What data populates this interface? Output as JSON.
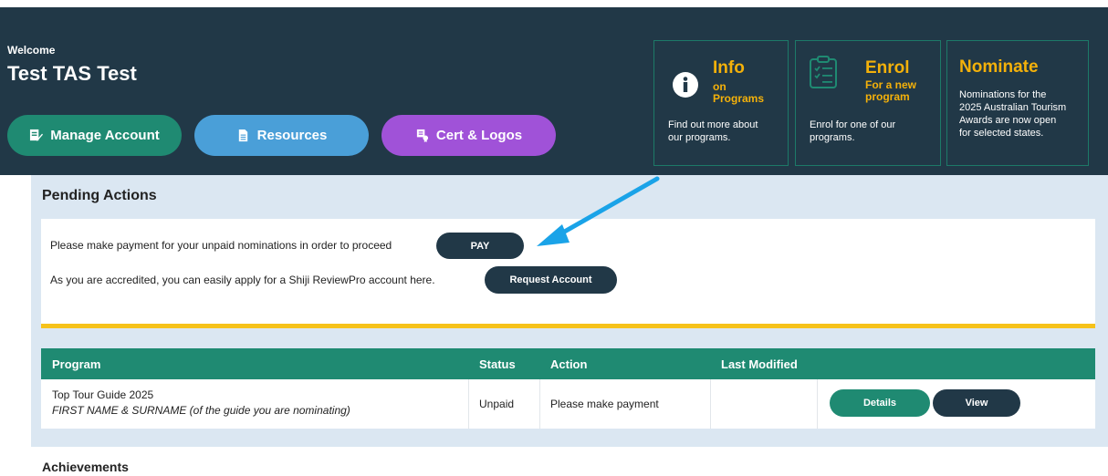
{
  "header": {
    "welcome_label": "Welcome",
    "user_name": "Test TAS Test",
    "background_color": "#213847"
  },
  "nav_buttons": [
    {
      "label": "Manage Account",
      "icon": "edit-icon",
      "color": "#1f8a72"
    },
    {
      "label": "Resources",
      "icon": "document-icon",
      "color": "#4a9fd8"
    },
    {
      "label": "Cert & Logos",
      "icon": "certificate-icon",
      "color": "#a052d8"
    }
  ],
  "cards": {
    "info": {
      "title": "Info",
      "subtitle_1": "on",
      "subtitle_2": "Programs",
      "desc_1": "Find out more about",
      "desc_2": "our programs.",
      "icon": "info-circle-icon"
    },
    "enrol": {
      "title": "Enrol",
      "subtitle_1": "For a new",
      "subtitle_2": "program",
      "desc_1": "Enrol for one of our",
      "desc_2": "programs.",
      "icon": "clipboard-checklist-icon"
    },
    "nominate": {
      "title": "Nominate",
      "desc_1": "Nominations for the",
      "desc_2": "2025 Australian Tourism",
      "desc_3": "Awards are now open",
      "desc_4": "for selected states."
    }
  },
  "pending": {
    "title": "Pending Actions",
    "payment_text": "Please make payment for your unpaid nominations in order to proceed",
    "pay_label": "PAY",
    "accredited_text": "As you are accredited, you can easily apply for a Shiji ReviewPro account here.",
    "request_label": "Request Account"
  },
  "table": {
    "columns": [
      "Program",
      "Status",
      "Action",
      "Last Modified"
    ],
    "rows": [
      {
        "program": "Top Tour Guide 2025",
        "program_note": "FIRST NAME & SURNAME (of the guide you are nominating)",
        "status": "Unpaid",
        "action": "Please make payment",
        "last_modified": "",
        "details_label": "Details",
        "view_label": "View"
      }
    ]
  },
  "achievements": {
    "title": "Achievements"
  },
  "colors": {
    "accent_green": "#1f8a72",
    "accent_yellow": "#f4b10a",
    "bar_yellow": "#f6c21a",
    "arrow_blue": "#1aa3e8"
  }
}
